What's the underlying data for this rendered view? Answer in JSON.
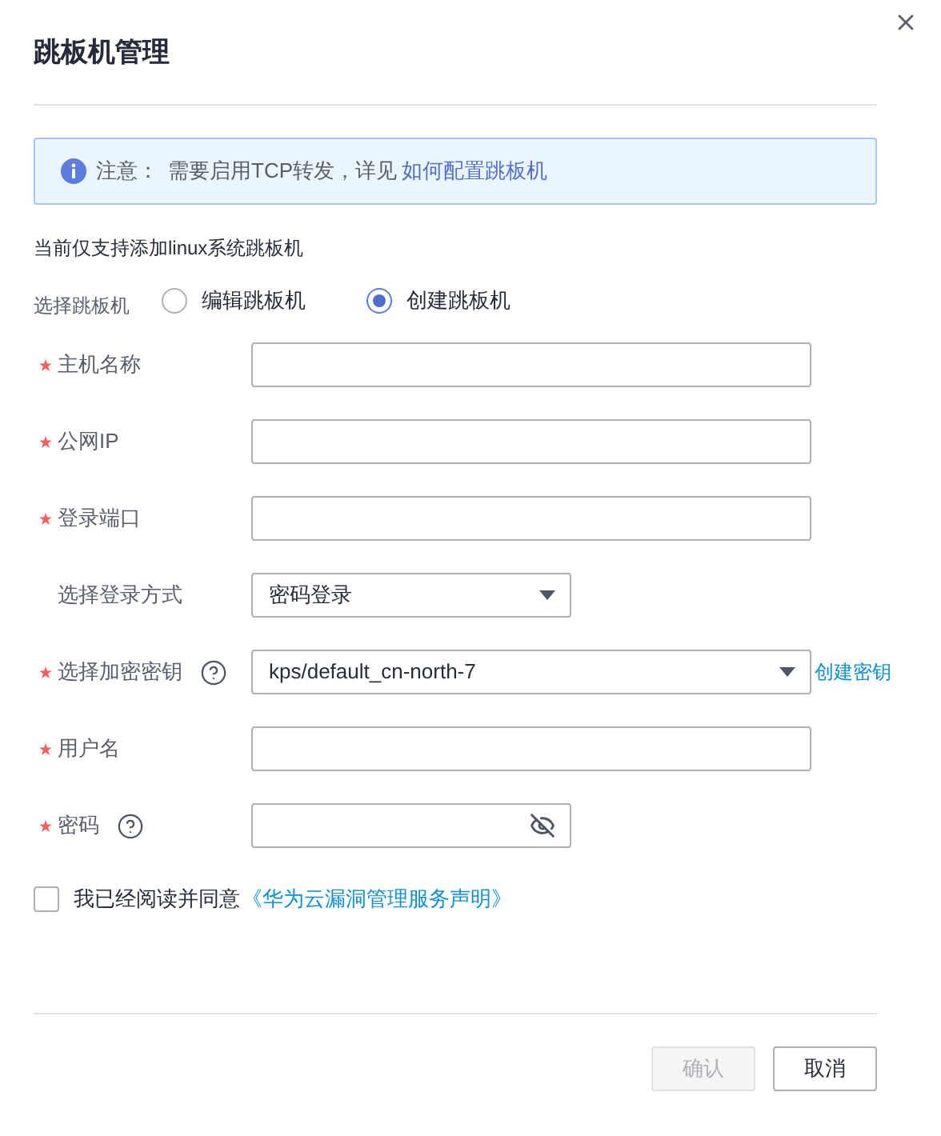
{
  "dialog": {
    "title": "跳板机管理"
  },
  "notice": {
    "label": "注意：",
    "text": "需要启用TCP转发，详见",
    "link": "如何配置跳板机"
  },
  "hint": "当前仅支持添加linux系统跳板机",
  "jump_host": {
    "label": "选择跳板机",
    "options": [
      {
        "label": "编辑跳板机",
        "selected": false
      },
      {
        "label": "创建跳板机",
        "selected": true
      }
    ]
  },
  "fields": [
    {
      "kind": "text",
      "label": "主机名称",
      "required": true,
      "help": false,
      "wide": true
    },
    {
      "kind": "text",
      "label": "公网IP",
      "required": true,
      "help": false,
      "wide": true
    },
    {
      "kind": "text",
      "label": "登录端口",
      "required": true,
      "help": false,
      "wide": true
    },
    {
      "kind": "select",
      "label": "选择登录方式",
      "required": false,
      "help": false,
      "wide": false,
      "value": "密码登录"
    },
    {
      "kind": "select",
      "label": "选择加密密钥",
      "required": true,
      "help": true,
      "wide": true,
      "value": "kps/default_cn-north-7",
      "link": "创建密钥"
    },
    {
      "kind": "text",
      "label": "用户名",
      "required": true,
      "help": false,
      "wide": true
    },
    {
      "kind": "password",
      "label": "密码",
      "required": true,
      "help": true,
      "wide": false
    }
  ],
  "agreement": {
    "checked": false,
    "text": "我已经阅读并同意",
    "link": "《华为云漏洞管理服务声明》"
  },
  "buttons": [
    {
      "label": "确认",
      "disabled": true
    },
    {
      "label": "取消",
      "disabled": false
    }
  ]
}
